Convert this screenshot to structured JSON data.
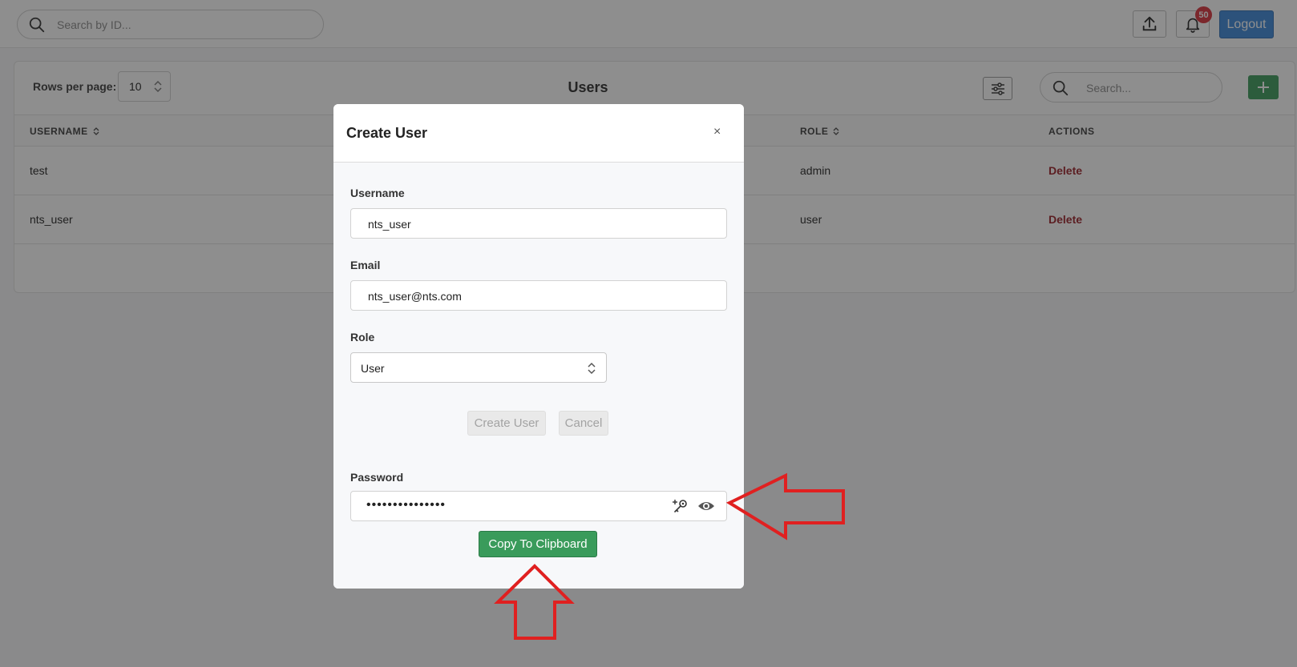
{
  "topbar": {
    "search_placeholder": "Search by ID...",
    "notification_count": "50",
    "logout_label": "Logout",
    "icons": [
      "search-icon",
      "upload-icon",
      "bell-icon"
    ]
  },
  "users_table": {
    "rows_per_page_label": "Rows per page:",
    "rows_per_page_value": "10",
    "title": "Users",
    "search_placeholder": "Search...",
    "add_label": "+",
    "columns": [
      "USERNAME",
      "ROLE",
      "ACTIONS"
    ],
    "rows": [
      {
        "username": "test",
        "role": "admin",
        "action": "Delete"
      },
      {
        "username": "nts_user",
        "role": "user",
        "action": "Delete"
      }
    ]
  },
  "modal": {
    "title": "Create User",
    "close_label": "×",
    "username_label": "Username",
    "username_value": "nts_user",
    "email_label": "Email",
    "email_value": "nts_user@nts.com",
    "role_label": "Role",
    "role_value": "User",
    "create_label": "Create User",
    "cancel_label": "Cancel",
    "password_label": "Password",
    "password_value": "•••••••••••••••",
    "copy_label": "Copy To Clipboard"
  },
  "colors": {
    "primary_blue": "#3a86d8",
    "success_green": "#3a9b5b",
    "danger_red": "#9a1e26",
    "annotation_red": "#e02020"
  }
}
